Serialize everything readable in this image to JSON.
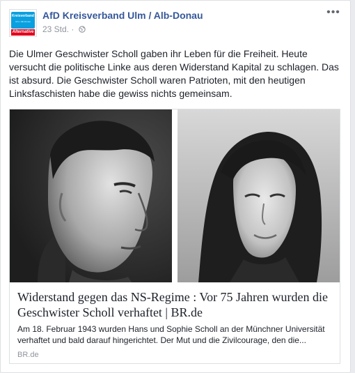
{
  "post": {
    "page_name": "AfD Kreisverband Ulm / Alb-Donau",
    "timestamp": "23 Std.",
    "separator": "·",
    "privacy_icon": "globe-icon",
    "more_icon": "more-options-icon",
    "more_label": "•••",
    "avatar": {
      "top_text": "Kreisverband",
      "mid_text": "Ulm / Alb-Donau",
      "bottom_text": "Alternative",
      "colors": {
        "blue": "#0aa0e0",
        "red": "#e3001b"
      }
    },
    "text": "Die Ulmer Geschwister Scholl gaben ihr Leben für die Freiheit. Heute versucht die politische Linke aus deren Widerstand Kapital zu schlagen. Das ist absurd. Die Geschwister Scholl waren Patrioten, mit den heutigen Linksfaschisten habe die gewiss nichts gemeinsam."
  },
  "link_preview": {
    "title": "Widerstand gegen das NS-Regime : Vor 75 Jahren wurden die Geschwister Scholl verhaftet | BR.de",
    "description": "Am 18. Februar 1943 wurden Hans und Sophie Scholl an der Münchner Universität verhaftet und bald darauf hingerichtet. Der Mut und die Zivilcourage, den die...",
    "domain": "BR.de",
    "images": [
      "black-and-white-portrait-man-profile",
      "black-and-white-portrait-woman"
    ]
  },
  "colors": {
    "link_blue": "#365899",
    "meta_grey": "#90949c",
    "text": "#1d2129",
    "border": "#dddfe2"
  }
}
